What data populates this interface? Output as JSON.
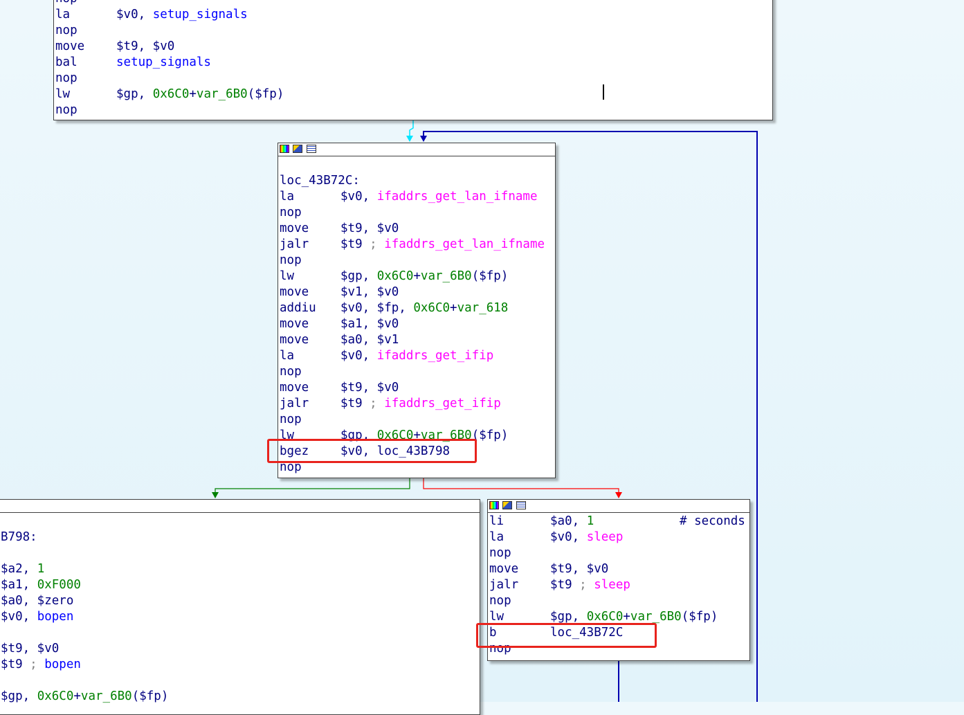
{
  "colors": {
    "background": "#e6f5fb",
    "mnemonic": "#000080",
    "symbol": "#0000ff",
    "import": "#ff00ff",
    "number": "#008000",
    "highlight_box": "#e8231d",
    "edge_true": "#008000",
    "edge_false": "#ff0000",
    "edge_flow": "#0000b0",
    "edge_cursor": "#00e5ff"
  },
  "icons": [
    "color-palette-icon",
    "rename-icon",
    "graph-view-icon"
  ],
  "blocks": {
    "top": {
      "lines": [
        [
          {
            "t": "nop",
            "c": "mn"
          }
        ],
        [
          {
            "t": "la",
            "c": "mn"
          },
          {
            "t": "$v0, ",
            "c": "reg"
          },
          {
            "t": "setup_signals",
            "c": "sym"
          }
        ],
        [
          {
            "t": "nop",
            "c": "mn"
          }
        ],
        [
          {
            "t": "move",
            "c": "mn"
          },
          {
            "t": "$t9, $v0",
            "c": "reg"
          }
        ],
        [
          {
            "t": "bal",
            "c": "mn"
          },
          {
            "t": "setup_signals",
            "c": "sym"
          }
        ],
        [
          {
            "t": "nop",
            "c": "mn"
          }
        ],
        [
          {
            "t": "lw",
            "c": "mn"
          },
          {
            "t": "$gp, ",
            "c": "reg"
          },
          {
            "t": "0x6C0",
            "c": "num"
          },
          {
            "t": "+",
            "c": "reg"
          },
          {
            "t": "var_6B0",
            "c": "var"
          },
          {
            "t": "($fp)",
            "c": "reg"
          }
        ],
        [
          {
            "t": "nop",
            "c": "mn"
          }
        ]
      ]
    },
    "mid": {
      "lines": [
        [],
        [
          {
            "t": "loc_43B72C:",
            "c": "label"
          }
        ],
        [
          {
            "t": "la",
            "c": "mn"
          },
          {
            "t": "$v0, ",
            "c": "reg"
          },
          {
            "t": "ifaddrs_get_lan_ifname",
            "c": "imp"
          }
        ],
        [
          {
            "t": "nop",
            "c": "mn"
          }
        ],
        [
          {
            "t": "move",
            "c": "mn"
          },
          {
            "t": "$t9, $v0",
            "c": "reg"
          }
        ],
        [
          {
            "t": "jalr",
            "c": "mn"
          },
          {
            "t": "$t9 ",
            "c": "reg"
          },
          {
            "t": "; ",
            "c": "semi"
          },
          {
            "t": "ifaddrs_get_lan_ifname",
            "c": "imp"
          }
        ],
        [
          {
            "t": "nop",
            "c": "mn"
          }
        ],
        [
          {
            "t": "lw",
            "c": "mn"
          },
          {
            "t": "$gp, ",
            "c": "reg"
          },
          {
            "t": "0x6C0",
            "c": "num"
          },
          {
            "t": "+",
            "c": "reg"
          },
          {
            "t": "var_6B0",
            "c": "var"
          },
          {
            "t": "($fp)",
            "c": "reg"
          }
        ],
        [
          {
            "t": "move",
            "c": "mn"
          },
          {
            "t": "$v1, $v0",
            "c": "reg"
          }
        ],
        [
          {
            "t": "addiu",
            "c": "mn"
          },
          {
            "t": "$v0, $fp, ",
            "c": "reg"
          },
          {
            "t": "0x6C0",
            "c": "num"
          },
          {
            "t": "+",
            "c": "reg"
          },
          {
            "t": "var_618",
            "c": "var"
          }
        ],
        [
          {
            "t": "move",
            "c": "mn"
          },
          {
            "t": "$a1, $v0",
            "c": "reg"
          }
        ],
        [
          {
            "t": "move",
            "c": "mn"
          },
          {
            "t": "$a0, $v1",
            "c": "reg"
          }
        ],
        [
          {
            "t": "la",
            "c": "mn"
          },
          {
            "t": "$v0, ",
            "c": "reg"
          },
          {
            "t": "ifaddrs_get_ifip",
            "c": "imp"
          }
        ],
        [
          {
            "t": "nop",
            "c": "mn"
          }
        ],
        [
          {
            "t": "move",
            "c": "mn"
          },
          {
            "t": "$t9, $v0",
            "c": "reg"
          }
        ],
        [
          {
            "t": "jalr",
            "c": "mn"
          },
          {
            "t": "$t9 ",
            "c": "reg"
          },
          {
            "t": "; ",
            "c": "semi"
          },
          {
            "t": "ifaddrs_get_ifip",
            "c": "imp"
          }
        ],
        [
          {
            "t": "nop",
            "c": "mn"
          }
        ],
        [
          {
            "t": "lw",
            "c": "mn"
          },
          {
            "t": "$gp, ",
            "c": "reg"
          },
          {
            "t": "0x6C0",
            "c": "num"
          },
          {
            "t": "+",
            "c": "reg"
          },
          {
            "t": "var_6B0",
            "c": "var"
          },
          {
            "t": "($fp)",
            "c": "reg"
          }
        ],
        [
          {
            "t": "bgez",
            "c": "mn"
          },
          {
            "t": "$v0, loc_43B798",
            "c": "reg"
          }
        ],
        [
          {
            "t": "nop",
            "c": "mn"
          }
        ]
      ]
    },
    "left": {
      "lines": [
        [],
        [
          {
            "t": "B798:",
            "c": "label"
          }
        ],
        [],
        [
          {
            "t": "$a2, ",
            "c": "reg"
          },
          {
            "t": "1",
            "c": "num"
          }
        ],
        [
          {
            "t": "$a1, ",
            "c": "reg"
          },
          {
            "t": "0xF000",
            "c": "num"
          }
        ],
        [
          {
            "t": "$a0, $zero",
            "c": "reg"
          }
        ],
        [
          {
            "t": "$v0, ",
            "c": "reg"
          },
          {
            "t": "bopen",
            "c": "sym"
          }
        ],
        [],
        [
          {
            "t": "$t9, $v0",
            "c": "reg"
          }
        ],
        [
          {
            "t": "$t9 ",
            "c": "reg"
          },
          {
            "t": "; ",
            "c": "semi"
          },
          {
            "t": "bopen",
            "c": "sym"
          }
        ],
        [],
        [
          {
            "t": "$gp, ",
            "c": "reg"
          },
          {
            "t": "0x6C0",
            "c": "num"
          },
          {
            "t": "+",
            "c": "reg"
          },
          {
            "t": "var_6B0",
            "c": "var"
          },
          {
            "t": "($fp)",
            "c": "reg"
          }
        ]
      ]
    },
    "right": {
      "lines": [
        [
          {
            "t": "li",
            "c": "mn"
          },
          {
            "t": "$a0, ",
            "c": "reg"
          },
          {
            "t": "1",
            "c": "num"
          },
          {
            "t": "# seconds",
            "c": "cmt"
          }
        ],
        [
          {
            "t": "la",
            "c": "mn"
          },
          {
            "t": "$v0, ",
            "c": "reg"
          },
          {
            "t": "sleep",
            "c": "imp"
          }
        ],
        [
          {
            "t": "nop",
            "c": "mn"
          }
        ],
        [
          {
            "t": "move",
            "c": "mn"
          },
          {
            "t": "$t9, $v0",
            "c": "reg"
          }
        ],
        [
          {
            "t": "jalr",
            "c": "mn"
          },
          {
            "t": "$t9 ",
            "c": "reg"
          },
          {
            "t": "; ",
            "c": "semi"
          },
          {
            "t": "sleep",
            "c": "imp"
          }
        ],
        [
          {
            "t": "nop",
            "c": "mn"
          }
        ],
        [
          {
            "t": "lw",
            "c": "mn"
          },
          {
            "t": "$gp, ",
            "c": "reg"
          },
          {
            "t": "0x6C0",
            "c": "num"
          },
          {
            "t": "+",
            "c": "reg"
          },
          {
            "t": "var_6B0",
            "c": "var"
          },
          {
            "t": "($fp)",
            "c": "reg"
          }
        ],
        [
          {
            "t": "b",
            "c": "mn"
          },
          {
            "t": "loc_43B72C",
            "c": "reg"
          }
        ],
        [
          {
            "t": "nop",
            "c": "mn"
          }
        ]
      ]
    }
  }
}
